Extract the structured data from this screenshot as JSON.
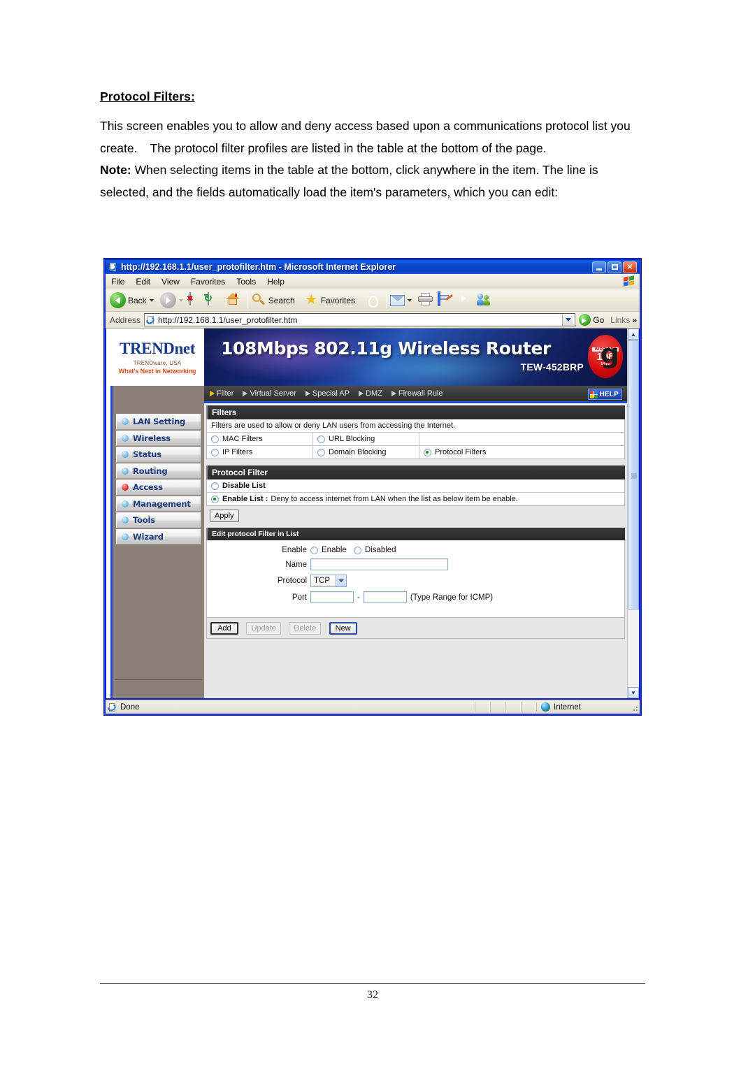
{
  "document": {
    "heading": "Protocol Filters:",
    "para1_a": "This screen enables you to allow and deny access based upon a communications protocol list you create.",
    "para1_b": "The protocol filter profiles are listed in the table at the bottom of the page.",
    "note_label": "Note:",
    "note_text": " When selecting items in the table at the bottom, click anywhere in the item. The line is selected, and the fields automatically load the item's parameters, which you can edit:",
    "page_number": "32"
  },
  "browser": {
    "title": "http://192.168.1.1/user_protofilter.htm - Microsoft Internet Explorer",
    "window_buttons": {
      "minimize": "_",
      "maximize": "□",
      "close": "✕"
    },
    "menu": [
      "File",
      "Edit",
      "View",
      "Favorites",
      "Tools",
      "Help"
    ],
    "toolbar": {
      "back": "Back",
      "forward": "",
      "stop": "",
      "refresh": "",
      "home": "",
      "search": "Search",
      "favorites": "Favorites",
      "history": "",
      "mail": "",
      "print": "",
      "edit": "",
      "discuss": "",
      "messenger": ""
    },
    "address": {
      "label": "Address",
      "url": "http://192.168.1.1/user_protofilter.htm",
      "go": "Go",
      "links": "Links",
      "more": "»"
    },
    "status": {
      "text": "Done",
      "zone": "Internet"
    }
  },
  "router": {
    "logo": {
      "brand_trend": "TRENDnet",
      "sub1": "TRENDware, USA",
      "sub2": "What's Next in Networking"
    },
    "banner": {
      "title": "108Mbps 802.11g Wireless Router",
      "model": "TEW-452BRP",
      "badge_wireless": "WIRELESS",
      "badge_108": "108",
      "badge_mbps": "Mbps",
      "badge_g": "g"
    },
    "nav": [
      {
        "label": "Filter",
        "active": true
      },
      {
        "label": "Virtual Server",
        "active": false
      },
      {
        "label": "Special AP",
        "active": false
      },
      {
        "label": "DMZ",
        "active": false
      },
      {
        "label": "Firewall Rule",
        "active": false
      }
    ],
    "help_label": "HELP",
    "sidebar": [
      {
        "label": "LAN Setting",
        "selected": false
      },
      {
        "label": "Wireless",
        "selected": false
      },
      {
        "label": "Status",
        "selected": false
      },
      {
        "label": "Routing",
        "selected": false
      },
      {
        "label": "Access",
        "selected": true
      },
      {
        "label": "Management",
        "selected": false
      },
      {
        "label": "Tools",
        "selected": false
      },
      {
        "label": "Wizard",
        "selected": false
      }
    ],
    "filters_panel": {
      "title": "Filters",
      "description": "Filters are used to allow or deny LAN users from accessing the Internet.",
      "options": [
        {
          "label": "MAC Filters",
          "checked": false
        },
        {
          "label": "URL Blocking",
          "checked": false
        },
        {
          "label": "IP Filters",
          "checked": false
        },
        {
          "label": "Domain Blocking",
          "checked": false
        },
        {
          "label": "Protocol Filters",
          "checked": true
        }
      ]
    },
    "protocol_filter_panel": {
      "title": "Protocol Filter",
      "disable_label": "Disable List",
      "disable_checked": false,
      "enable_label": "Enable List :",
      "enable_desc": "Deny to access internet from LAN when the list as below item be enable.",
      "enable_checked": true,
      "apply_button": "Apply"
    },
    "edit_panel": {
      "title": "Edit protocol Filter in List",
      "enable_label": "Enable",
      "enable_option": "Enable",
      "disabled_option": "Disabled",
      "enable_checked": false,
      "disabled_checked": false,
      "name_label": "Name",
      "name_value": "",
      "protocol_label": "Protocol",
      "protocol_value": "TCP",
      "port_label": "Port",
      "port_from": "",
      "port_to": "",
      "port_dash": "-",
      "port_hint": "(Type Range for ICMP)",
      "buttons": [
        {
          "label": "Add",
          "disabled": false,
          "style": "strong"
        },
        {
          "label": "Update",
          "disabled": true,
          "style": "plain"
        },
        {
          "label": "Delete",
          "disabled": true,
          "style": "plain"
        },
        {
          "label": "New",
          "disabled": false,
          "style": "blueframe"
        }
      ]
    }
  }
}
